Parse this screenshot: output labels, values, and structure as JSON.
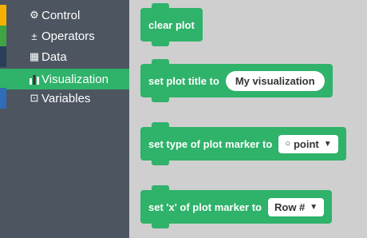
{
  "sidebar": {
    "categories": [
      {
        "label": "Control",
        "icon": "gear-icon",
        "glyph": "⚙",
        "stripe": "#f4b000"
      },
      {
        "label": "Operators",
        "icon": "plus-minus-icon",
        "glyph": "±",
        "stripe": "#3fa544"
      },
      {
        "label": "Data",
        "icon": "table-icon",
        "glyph": "▦",
        "stripe": "#2a3d5a"
      },
      {
        "label": "Visualization",
        "icon": "bar-chart-icon",
        "glyph": "▐",
        "stripe": "#2fb26a"
      },
      {
        "label": "Variables",
        "icon": "variable-box-icon",
        "glyph": "⊡",
        "stripe": "#2f6db8"
      }
    ]
  },
  "workspace": {
    "blocks": [
      {
        "text": "clear plot"
      },
      {
        "text": "set plot title to",
        "input": "My visualization"
      },
      {
        "text": "set type of plot marker to",
        "dropdown": "point",
        "dropdown_icon": "○"
      },
      {
        "text": "set 'x' of plot marker to",
        "dropdown": "Row #"
      }
    ]
  },
  "colors": {
    "sidebar_bg": "#4d5561",
    "block_green": "#2fb26a",
    "workspace_bg": "#cfcfcf"
  }
}
